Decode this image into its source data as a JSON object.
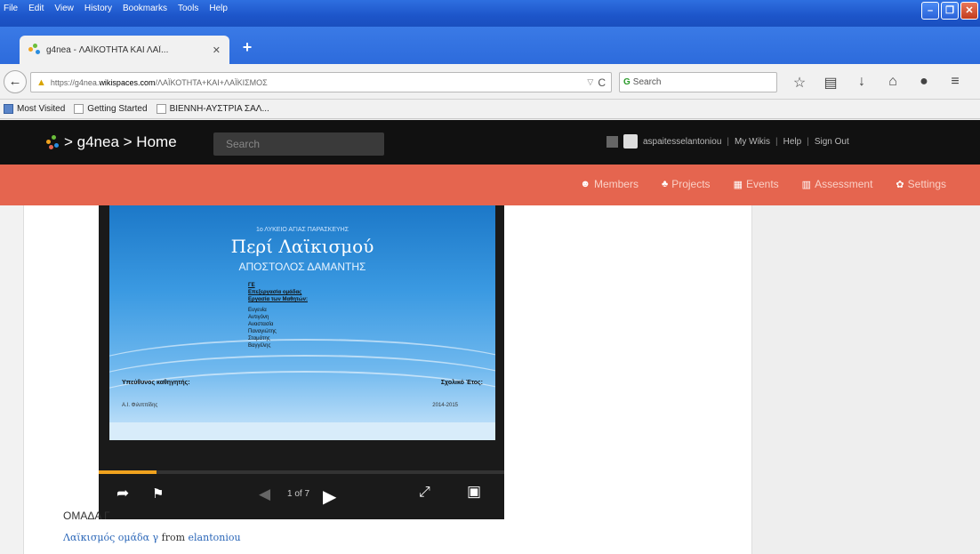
{
  "browser": {
    "menus": [
      "File",
      "Edit",
      "View",
      "History",
      "Bookmarks",
      "Tools",
      "Help"
    ],
    "tab_title": "g4nea - ΛΑΪΚΟΤΗΤΑ ΚΑΙ ΛΑΪ...",
    "url_prefix": "https://g4nea.",
    "url_domain": "wikispaces.com",
    "url_path": "/ΛΑΪΚΟΤΗΤΑ+ΚΑΙ+ΛΑΪΚΙΣΜΟΣ",
    "search_placeholder": "Search",
    "bookmarks": [
      "Most Visited",
      "Getting Started",
      "ΒΙΕΝΝΗ-ΑΥΣΤΡΙΑ ΣΑΛ..."
    ]
  },
  "site": {
    "brand": "> g4nea > Home",
    "search_placeholder": "Search",
    "username": "aspaitesselantoniou",
    "links": [
      "My Wikis",
      "Help",
      "Sign Out"
    ],
    "nav": [
      "Members",
      "Projects",
      "Events",
      "Assessment",
      "Settings"
    ]
  },
  "slide": {
    "small_heading": "1ο ΛΥΚΕΙΟ ΑΓΙΑΣ ΠΑΡΑΣΚΕΥΗΣ",
    "title": "Περί Λαϊκισμού",
    "author": "ΑΠΟΣΤΟΛΟΣ ΔΑΜΑΝΤΗΣ",
    "group": "ΓΕ",
    "line1": "Επεξεργασία ομάδας",
    "line2": "Εργασία των Μαθητών:",
    "names": [
      "Ευγενία",
      "Αντιγόνη",
      "Αναστασία",
      "Παναγιώτης",
      "Σταμάτης",
      "Βαγγέλης"
    ],
    "foot_left": "Υπεύθυνος καθηγητής:",
    "foot_right": "Σχολικό Έτος:",
    "foot2_left": "Α.Ι. Φιλιππίδης",
    "foot2_right": "2014-2015"
  },
  "player": {
    "page": "1 of 7",
    "progress": 0.143
  },
  "content": {
    "group_label": "ΟΜΑΔΑ Γ",
    "credit_title": "Λαϊκισμός ομάδα γ",
    "credit_from": "from",
    "credit_author": "elantoniou"
  },
  "colors": {
    "orange_nav": "#e5654f",
    "site_header": "#111111",
    "xp_blue": "#2e6fe0",
    "progress": "#f0a21e"
  }
}
